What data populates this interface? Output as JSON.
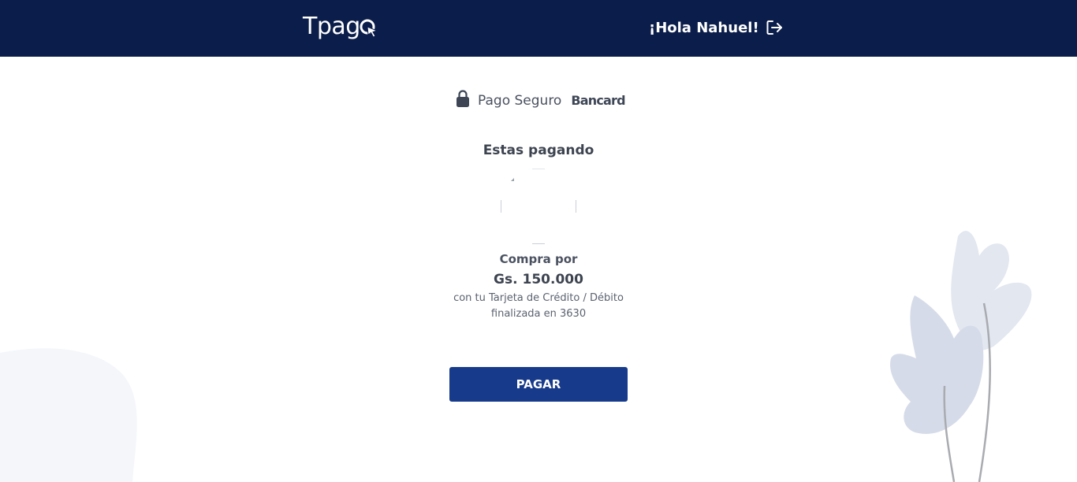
{
  "header": {
    "logo_text": "Tpag",
    "greeting": "¡Hola Nahuel!",
    "logout_icon": "logout-icon"
  },
  "secure_badge": {
    "label": "Pago Seguro",
    "provider": "Bancard",
    "icon": "lock-icon"
  },
  "payment": {
    "title": "Estas pagando",
    "purchase_label": "Compra por",
    "amount": "Gs. 150.000",
    "card_line1": "con tu Tarjeta de Crédito / Débito",
    "card_line2": "finalizada en 3630"
  },
  "actions": {
    "pay_label": "PAGAR"
  },
  "colors": {
    "header_bg": "#0b1d4a",
    "button_bg": "#173a8a",
    "decor": "#dfe4ee"
  }
}
